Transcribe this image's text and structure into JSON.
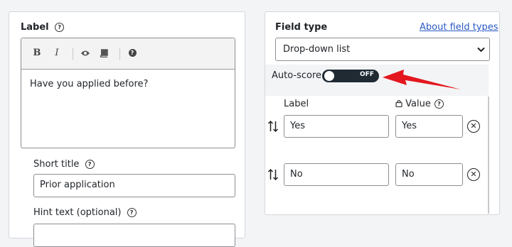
{
  "left": {
    "label_title": "Label",
    "toolbar": {
      "bold": "B",
      "italic": "I",
      "preview_icon": "eye-icon",
      "book_icon": "book-icon",
      "help": "?"
    },
    "editor_text": "Have you applied before?",
    "short_title_label": "Short title",
    "short_title_value": "Prior application",
    "hint_label": "Hint text (optional)"
  },
  "right": {
    "field_type_label": "Field type",
    "about_link": "About field types",
    "field_type_value": "Drop-down list",
    "autoscore_label": "Auto-score",
    "autoscore_state": "OFF",
    "col_label": "Label",
    "col_value": "Value",
    "options": [
      {
        "label": "Yes",
        "value": "Yes"
      },
      {
        "label": "No",
        "value": "No"
      }
    ]
  },
  "annotation": {
    "arrow_color": "#e3171e"
  }
}
